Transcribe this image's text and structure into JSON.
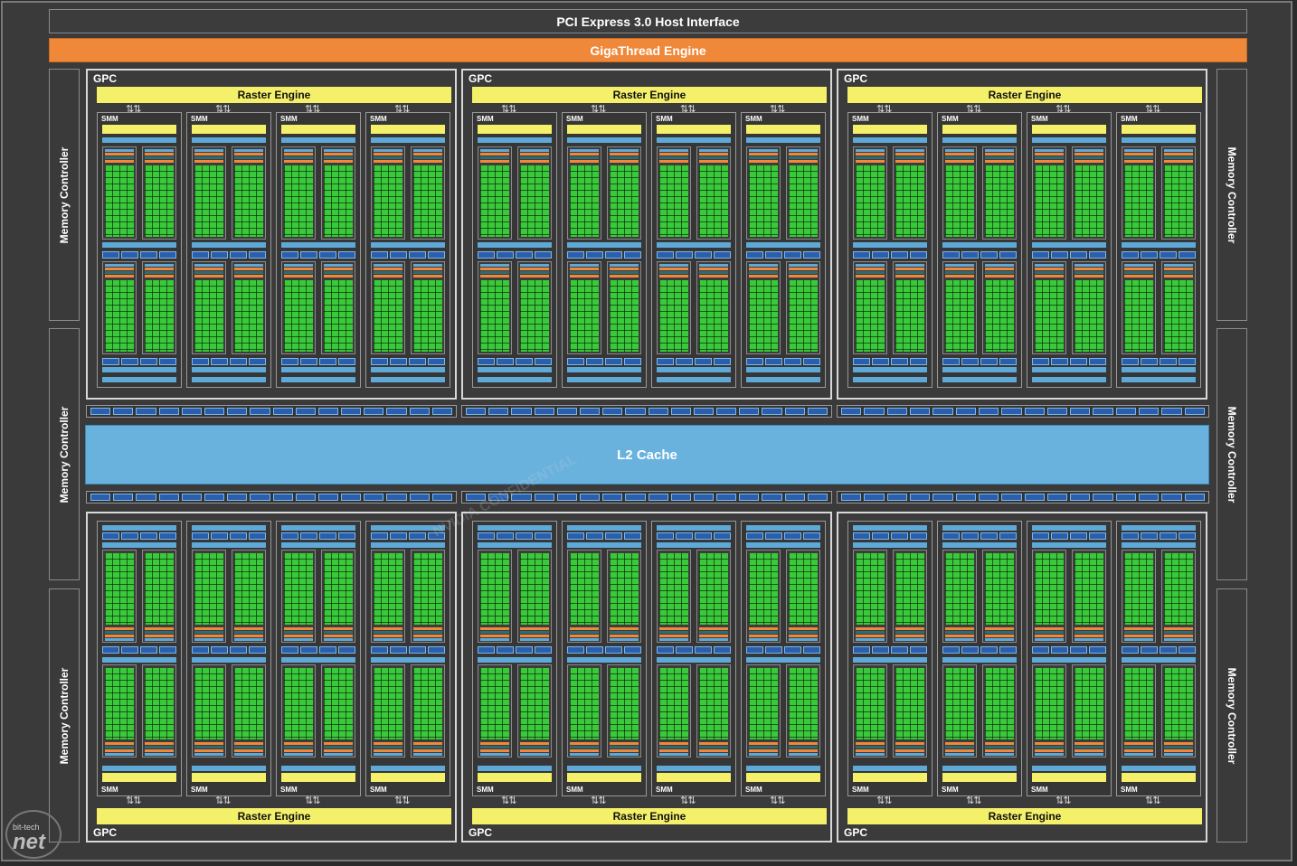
{
  "header": {
    "host_interface": "PCI Express 3.0 Host Interface",
    "scheduler": "GigaThread Engine"
  },
  "memory_controller_label": "Memory Controller",
  "gpc_label": "GPC",
  "raster_engine_label": "Raster Engine",
  "smm_label": "SMM",
  "l2_cache_label": "L2 Cache",
  "watermark": "NVIDIA CONFIDENTIAL",
  "logo": {
    "top": "bit-tech",
    "main": "net"
  },
  "colors": {
    "giga_thread": "#f0883a",
    "raster": "#f4f06a",
    "cuda_core": "#39c93a",
    "l2": "#6ab2de",
    "dispatch": "#2a5fae"
  }
}
